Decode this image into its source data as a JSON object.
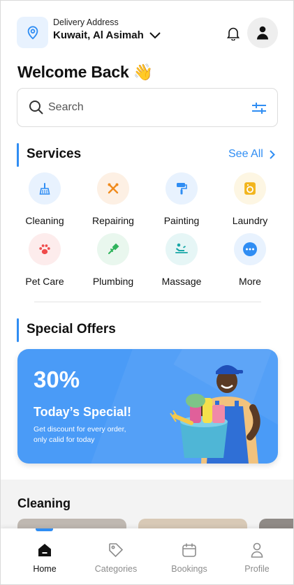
{
  "header": {
    "delivery_label": "Delivery Address",
    "delivery_value": "Kuwait, Al Asimah"
  },
  "welcome": {
    "text": "Welcome Back",
    "emoji": "👋"
  },
  "search": {
    "placeholder": "Search"
  },
  "services": {
    "title": "Services",
    "see_all": "See All",
    "items": [
      {
        "label": "Cleaning",
        "icon": "broom-icon",
        "bg": "#e8f2fe",
        "color": "#2f8df3"
      },
      {
        "label": "Repairing",
        "icon": "tools-icon",
        "bg": "#fdf0e4",
        "color": "#f08a1c"
      },
      {
        "label": "Painting",
        "icon": "paint-roller-icon",
        "bg": "#e8f2fe",
        "color": "#2f8df3"
      },
      {
        "label": "Laundry",
        "icon": "washing-machine-icon",
        "bg": "#fdf6e3",
        "color": "#f2b51d"
      },
      {
        "label": "Pet Care",
        "icon": "paw-icon",
        "bg": "#fdecec",
        "color": "#ef4b4b"
      },
      {
        "label": "Plumbing",
        "icon": "plunger-icon",
        "bg": "#e9f7ee",
        "color": "#2fb35c"
      },
      {
        "label": "Massage",
        "icon": "massage-icon",
        "bg": "#e6f6f6",
        "color": "#19a7a7"
      },
      {
        "label": "More",
        "icon": "more-icon",
        "bg": "#e8f2fe",
        "color": "#2f8df3"
      }
    ]
  },
  "offers": {
    "title": "Special Offers",
    "percent": "30%",
    "headline": "Today’s Special!",
    "desc_line1": "Get discount for every order,",
    "desc_line2": "only calid for today"
  },
  "cleaning": {
    "title": "Cleaning"
  },
  "tabs": [
    {
      "label": "Home",
      "icon": "home-icon",
      "active": true
    },
    {
      "label": "Categories",
      "icon": "tag-icon",
      "active": false
    },
    {
      "label": "Bookings",
      "icon": "calendar-icon",
      "active": false
    },
    {
      "label": "Profile",
      "icon": "user-icon",
      "active": false
    }
  ],
  "colors": {
    "accent": "#2f8df3",
    "offer_bg": "#4a9bf7"
  }
}
